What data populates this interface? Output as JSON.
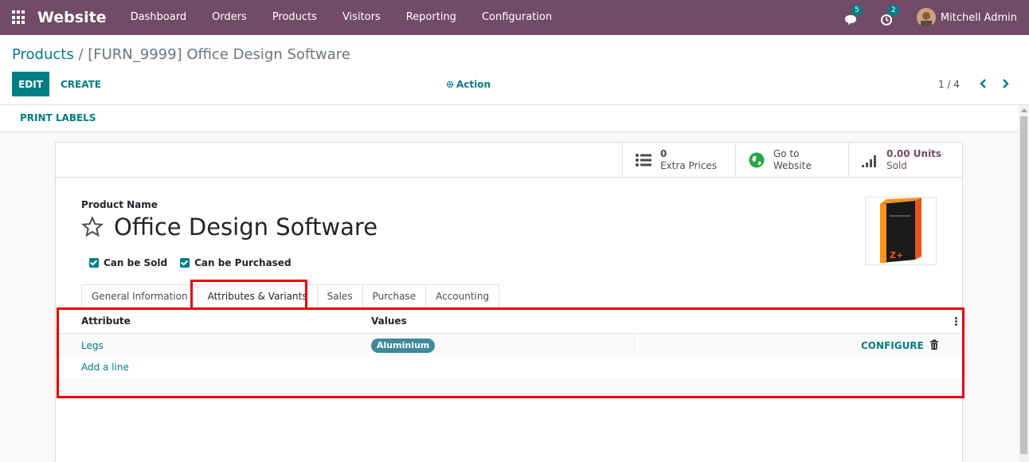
{
  "navbar": {
    "brand": "Website",
    "menu": [
      "Dashboard",
      "Orders",
      "Products",
      "Visitors",
      "Reporting",
      "Configuration"
    ],
    "chat_badge": "5",
    "activity_badge": "2",
    "user_name": "Mitchell Admin"
  },
  "control_panel": {
    "breadcrumb_parent": "Products",
    "breadcrumb_separator": " / ",
    "breadcrumb_current": "[FURN_9999] Office Design Software",
    "edit_label": "EDIT",
    "create_label": "CREATE",
    "action_label": "Action",
    "pager": "1 / 4"
  },
  "statusbar": {
    "print_labels": "PRINT LABELS"
  },
  "smart_buttons": {
    "extra_prices_value": "0",
    "extra_prices_label": "Extra Prices",
    "website_line1": "Go to",
    "website_line2": "Website",
    "sold_value": "0.00 Units",
    "sold_label": "Sold"
  },
  "form": {
    "product_name_label": "Product Name",
    "product_name": "Office Design Software",
    "can_be_sold": "Can be Sold",
    "can_be_purchased": "Can be Purchased"
  },
  "tabs": [
    "General Information",
    "Attributes & Variants",
    "Sales",
    "Purchase",
    "Accounting"
  ],
  "attributes_table": {
    "col_attribute": "Attribute",
    "col_values": "Values",
    "rows": [
      {
        "attribute": "Legs",
        "value": "Aluminium",
        "configure": "CONFIGURE"
      }
    ],
    "add_line": "Add a line"
  },
  "colors": {
    "navbar": "#714b67",
    "accent": "#017e84",
    "highlight": "#ea0000"
  }
}
